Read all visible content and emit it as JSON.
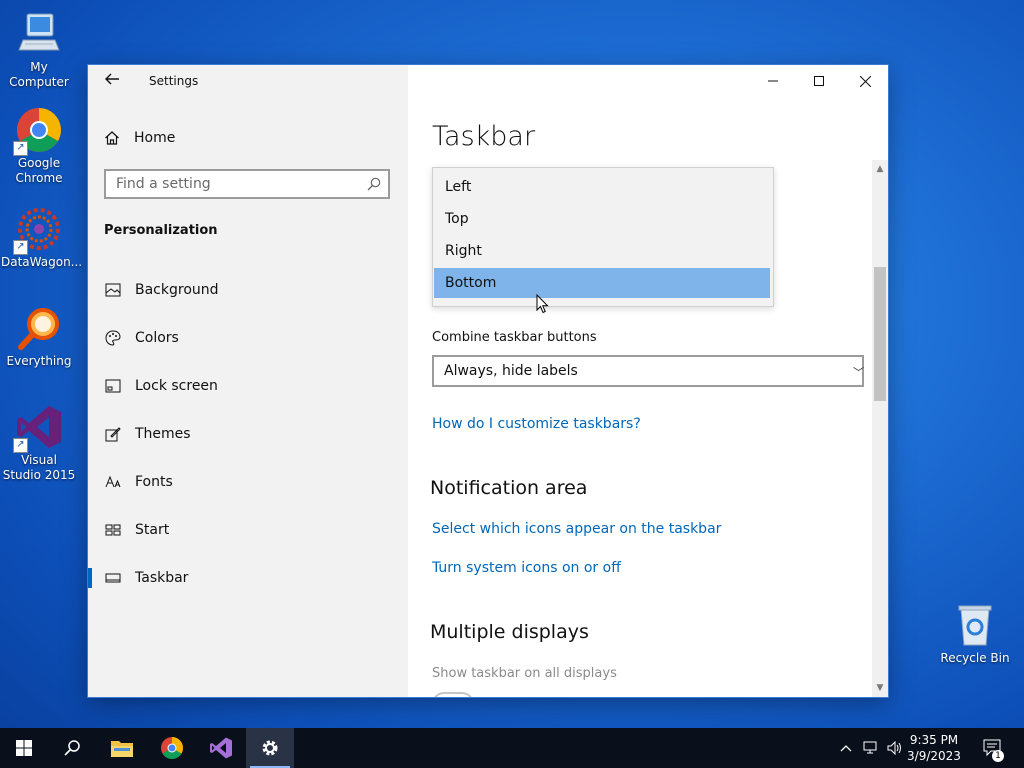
{
  "desktop": {
    "icons": [
      {
        "label": "My Computer"
      },
      {
        "label": "Google Chrome"
      },
      {
        "label": "DataWagon..."
      },
      {
        "label": "Everything"
      },
      {
        "label": "Visual Studio 2015"
      },
      {
        "label": "Recycle Bin"
      }
    ]
  },
  "window": {
    "app_title": "Settings",
    "controls": {
      "minimize": "minimize-icon",
      "maximize": "maximize-icon",
      "close": "close-icon"
    }
  },
  "nav": {
    "home_label": "Home",
    "search_placeholder": "Find a setting",
    "section": "Personalization",
    "items": [
      {
        "label": "Background",
        "icon": "picture-icon"
      },
      {
        "label": "Colors",
        "icon": "palette-icon"
      },
      {
        "label": "Lock screen",
        "icon": "lock-screen-icon"
      },
      {
        "label": "Themes",
        "icon": "brush-icon"
      },
      {
        "label": "Fonts",
        "icon": "font-icon"
      },
      {
        "label": "Start",
        "icon": "start-icon"
      },
      {
        "label": "Taskbar",
        "icon": "taskbar-icon",
        "selected": true
      }
    ]
  },
  "content": {
    "title": "Taskbar",
    "location_dropdown": {
      "options": [
        "Left",
        "Top",
        "Right",
        "Bottom"
      ],
      "selected": "Bottom"
    },
    "combine_label": "Combine taskbar buttons",
    "combine_value": "Always, hide labels",
    "customize_link": "How do I customize taskbars?",
    "notification_heading": "Notification area",
    "notification_links": [
      "Select which icons appear on the taskbar",
      "Turn system icons on or off"
    ],
    "multiple_heading": "Multiple displays",
    "show_on_all_label": "Show taskbar on all displays"
  },
  "taskbar": {
    "apps": [
      "windows-start-icon",
      "search-icon",
      "file-explorer-icon",
      "chrome-icon",
      "visual-studio-icon",
      "settings-icon"
    ],
    "active_app": "settings-icon",
    "time": "9:35 PM",
    "date": "3/9/2023",
    "notification_count": "1"
  }
}
